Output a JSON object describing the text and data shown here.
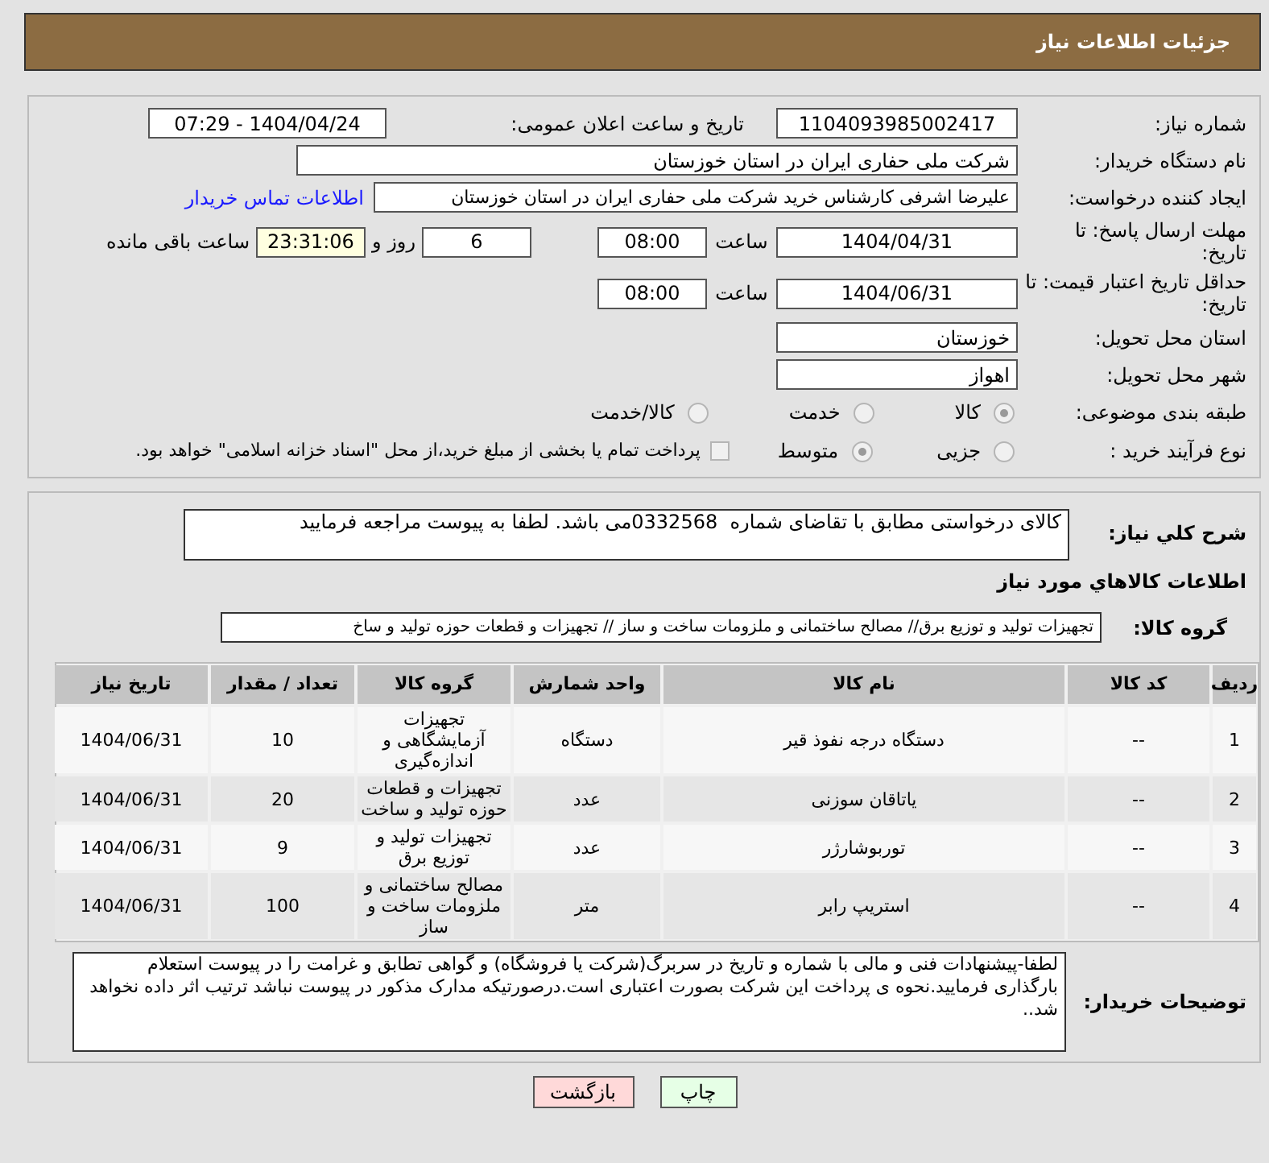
{
  "header": {
    "title": "جزئیات اطلاعات نیاز"
  },
  "need_number": {
    "label": "شماره نیاز:",
    "value": "1104093985002417"
  },
  "announce": {
    "label": "تاریخ و ساعت اعلان عمومی:",
    "value": "1404/04/24 - 07:29"
  },
  "buyer": {
    "label": "نام دستگاه خریدار:",
    "value": "شرکت ملی حفاری ایران در استان خوزستان"
  },
  "creator": {
    "label": "ایجاد کننده درخواست:",
    "value": "علیرضا اشرفی کارشناس خرید شرکت ملی حفاری ایران در استان خوزستان",
    "link": "اطلاعات تماس خریدار"
  },
  "deadline": {
    "label": "مهلت ارسال پاسخ: تا تاریخ:",
    "date": "1404/04/31",
    "time_label": "ساعت",
    "time": "08:00",
    "days": "6",
    "days_label": "روز و",
    "remaining": "23:31:06",
    "remaining_label": "ساعت باقی مانده"
  },
  "validity": {
    "label": "حداقل تاریخ اعتبار قیمت: تا تاریخ:",
    "date": "1404/06/31",
    "time_label": "ساعت",
    "time": "08:00"
  },
  "province": {
    "label": "استان محل تحویل:",
    "value": "خوزستان"
  },
  "city": {
    "label": "شهر محل تحویل:",
    "value": "اهواز"
  },
  "category": {
    "label": "طبقه بندی موضوعی:",
    "options": [
      {
        "label": "کالا",
        "selected": true
      },
      {
        "label": "خدمت",
        "selected": false
      },
      {
        "label": "کالا/خدمت",
        "selected": false
      }
    ]
  },
  "process": {
    "label": "نوع فرآیند خرید :",
    "options": [
      {
        "label": "جزیی",
        "selected": false
      },
      {
        "label": "متوسط",
        "selected": true
      }
    ],
    "treasury": {
      "checked": false,
      "text": "پرداخت تمام یا بخشی از مبلغ خرید،از محل \"اسناد خزانه اسلامی\" خواهد بود."
    }
  },
  "description": {
    "label": "شرح کلي نياز:",
    "value": "کالای درخواستی مطابق با تقاضای شماره  0332568می باشد. لطفا به پیوست مراجعه فرمایید"
  },
  "goods_heading": "اطلاعات کالاهاي مورد نياز",
  "goods_group": {
    "label": "گروه کالا:",
    "value": "تجهیزات تولید و توزیع برق// مصالح ساختمانی و ملزومات ساخت و ساز // تجهیزات و قطعات حوزه تولید و ساخ"
  },
  "table": {
    "columns": [
      "ردیف",
      "کد کالا",
      "نام کالا",
      "واحد شمارش",
      "گروه کالا",
      "تعداد / مقدار",
      "تاریخ نیاز"
    ],
    "rows": [
      [
        "1",
        "--",
        "دستگاه درجه نفوذ قیر",
        "دستگاه",
        "تجهیزات آزمایشگاهی و اندازه‌گیری",
        "10",
        "1404/06/31"
      ],
      [
        "2",
        "--",
        "یاتاقان سوزنی",
        "عدد",
        "تجهیزات و قطعات حوزه تولید و ساخت",
        "20",
        "1404/06/31"
      ],
      [
        "3",
        "--",
        "توربوشارژر",
        "عدد",
        "تجهیزات تولید و توزیع برق",
        "9",
        "1404/06/31"
      ],
      [
        "4",
        "--",
        "استریپ رابر",
        "متر",
        "مصالح ساختمانی و ملزومات ساخت و ساز",
        "100",
        "1404/06/31"
      ]
    ]
  },
  "buyer_notes": {
    "label": "توضیحات خریدار:",
    "value": "لطفا-پیشنهادات فنی و مالی با شماره و تاریخ در سربرگ(شرکت یا فروشگاه) و گواهی تطابق و غرامت را در پیوست استعلام بارگذاری فرمایید.نحوه ی پرداخت این شرکت بصورت اعتباری است.درصورتیکه مدارک مذکور در پیوست نباشد ترتیب اثر داده نخواهد شد.."
  },
  "buttons": [
    {
      "label": "چاپ",
      "kind": "print"
    },
    {
      "label": "بازگشت",
      "kind": "back"
    }
  ]
}
